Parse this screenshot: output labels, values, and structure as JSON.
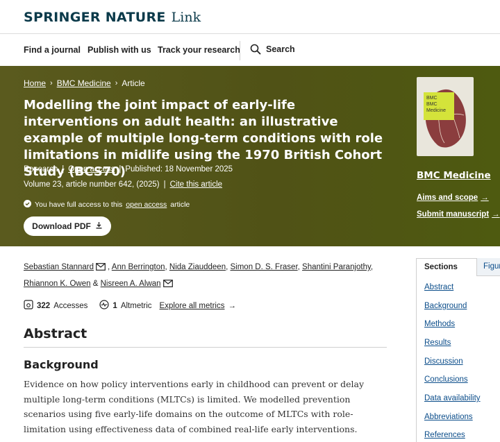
{
  "header": {
    "logo_main": "SPRINGER NATURE",
    "logo_link": "Link"
  },
  "nav": {
    "items": [
      "Find a journal",
      "Publish with us",
      "Track your research"
    ],
    "search_label": "Search"
  },
  "breadcrumb": {
    "home": "Home",
    "journal": "BMC Medicine",
    "current": "Article",
    "separator": "›"
  },
  "article": {
    "title": "Modelling the joint impact of early-life interventions on adult health: an illustrative example of multiple long-term conditions with role limitations in midlife using the 1970 British Cohort Study (BCS70)",
    "type": "Research",
    "open_access": "Open access",
    "published": "Published: 18 November 2025",
    "volume": "Volume 23, article number 642, (2025)",
    "cite": "Cite this article",
    "access_prefix": "You have full access to this",
    "access_link": "open access",
    "access_suffix": "article",
    "download": "Download PDF"
  },
  "journal_panel": {
    "cover_brand": "BMC",
    "cover_title": "BMC Medicine",
    "name": "BMC Medicine",
    "aims": "Aims and scope",
    "submit": "Submit manuscript"
  },
  "authors": {
    "list": [
      "Sebastian Stannard",
      "Ann Berrington",
      "Nida Ziauddeen",
      "Simon D. S. Fraser",
      "Shantini Paranjothy",
      "Rhiannon K. Owen",
      "Nisreen A. Alwan"
    ],
    "amp": "&"
  },
  "metrics": {
    "accesses_count": "322",
    "accesses_label": "Accesses",
    "altmetric_count": "1",
    "altmetric_label": "Altmetric",
    "explore": "Explore all metrics"
  },
  "abstract": {
    "heading": "Abstract",
    "sub_heading": "Background",
    "text": "Evidence on how policy interventions early in childhood can prevent or delay multiple long-term conditions (MLTCs) is limited. We modelled prevention scenarios using five early-life domains on the outcome of MLTCs with role-limitation using effectiveness data of combined real-life early interventions."
  },
  "sections_panel": {
    "tab_sections": "Sections",
    "tab_figures": "Figures",
    "items": [
      "Abstract",
      "Background",
      "Methods",
      "Results",
      "Discussion",
      "Conclusions",
      "Data availability",
      "Abbreviations",
      "References"
    ]
  },
  "colors": {
    "hero_bg": "#545418",
    "brand": "#0b3a4a",
    "link": "#0b4d8a"
  }
}
